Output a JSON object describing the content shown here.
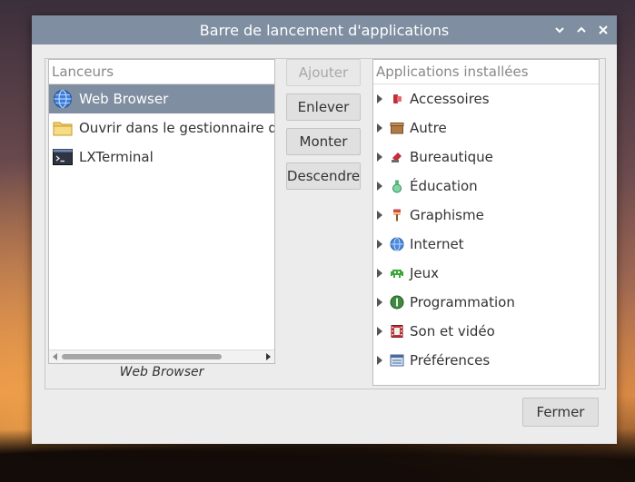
{
  "window": {
    "title": "Barre de lancement d'applications"
  },
  "launchers": {
    "header": "Lanceurs",
    "items": [
      {
        "label": "Web Browser",
        "icon": "globe-icon",
        "selected": true
      },
      {
        "label": "Ouvrir dans le gestionnaire de fichiers",
        "icon": "folder-icon",
        "selected": false
      },
      {
        "label": "LXTerminal",
        "icon": "terminal-icon",
        "selected": false
      }
    ],
    "caption": "Web Browser"
  },
  "buttons": {
    "add": "Ajouter",
    "remove": "Enlever",
    "up": "Monter",
    "down": "Descendre",
    "close": "Fermer"
  },
  "apps": {
    "header": "Applications installées",
    "categories": [
      {
        "label": "Accessoires",
        "icon": "accessories-icon"
      },
      {
        "label": "Autre",
        "icon": "box-icon"
      },
      {
        "label": "Bureautique",
        "icon": "office-icon"
      },
      {
        "label": "Éducation",
        "icon": "flask-icon"
      },
      {
        "label": "Graphisme",
        "icon": "brush-icon"
      },
      {
        "label": "Internet",
        "icon": "globe-icon"
      },
      {
        "label": "Jeux",
        "icon": "invader-icon"
      },
      {
        "label": "Programmation",
        "icon": "gear-icon"
      },
      {
        "label": "Son et vidéo",
        "icon": "film-icon"
      },
      {
        "label": "Préférences",
        "icon": "preferences-icon"
      }
    ]
  },
  "colors": {
    "accent": "#7f8ea1",
    "window_bg": "#ececec"
  }
}
